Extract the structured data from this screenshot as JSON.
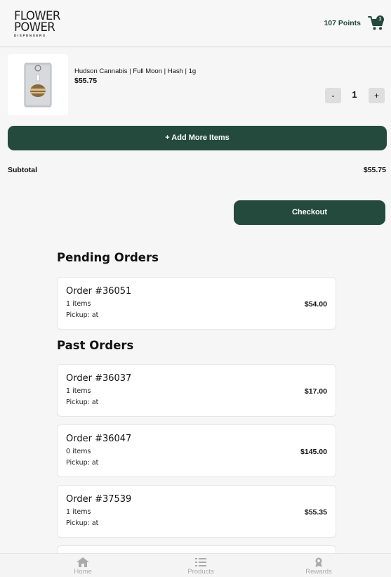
{
  "header": {
    "logo_line1": "FLOWER",
    "logo_line2": "POWER",
    "logo_line3": "DISPENSERS",
    "points": "107 Points",
    "cart_count": "1"
  },
  "cart": {
    "item": {
      "name": "Hudson Cannabis | Full Moon | Hash | 1g",
      "price": "$55.75",
      "qty_minus": "-",
      "quantity": "1",
      "qty_plus": "+"
    },
    "add_more_label": "+ Add More Items",
    "subtotal_label": "Subtotal",
    "subtotal_value": "$55.75",
    "checkout_label": "Checkout"
  },
  "pending": {
    "title": "Pending Orders",
    "orders": [
      {
        "title": "Order #36051",
        "items": "1 items",
        "pickup": "Pickup: at",
        "total": "$54.00"
      }
    ]
  },
  "past": {
    "title": "Past Orders",
    "orders": [
      {
        "title": "Order #36037",
        "items": "1 items",
        "pickup": "Pickup: at",
        "total": "$17.00"
      },
      {
        "title": "Order #36047",
        "items": "0 items",
        "pickup": "Pickup: at",
        "total": "$145.00"
      },
      {
        "title": "Order #37539",
        "items": "1 items",
        "pickup": "Pickup: at",
        "total": "$55.35"
      }
    ]
  },
  "nav": {
    "items": [
      {
        "label": "Home",
        "icon": "home-icon"
      },
      {
        "label": "Products",
        "icon": "list-icon"
      },
      {
        "label": "Rewards",
        "icon": "award-icon"
      }
    ]
  },
  "colors": {
    "brand": "#244a3e",
    "background": "#f6f6f6",
    "nav_inactive": "#aaaaaa"
  }
}
